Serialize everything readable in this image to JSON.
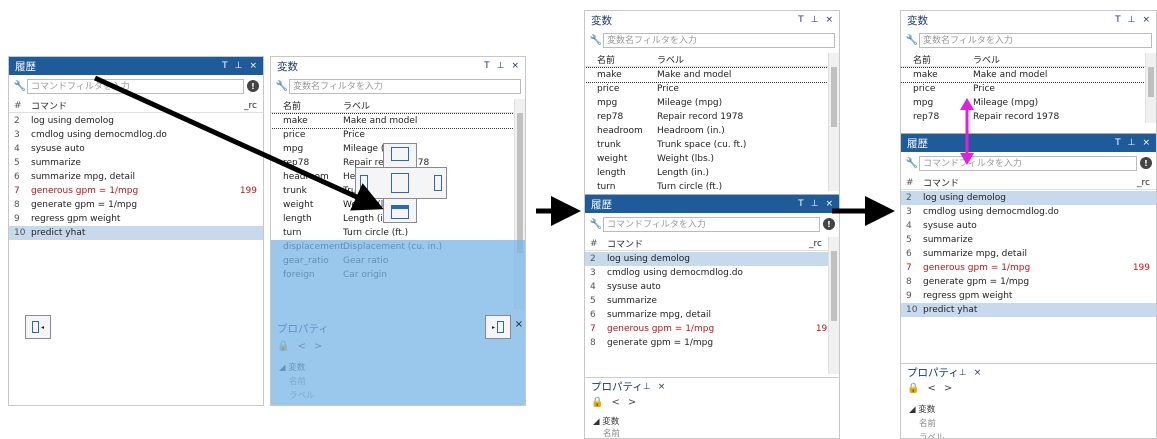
{
  "history": {
    "title": "履歴",
    "filter_placeholder": "コマンドフィルタを入力",
    "col_num": "#",
    "col_cmd": "コマンド",
    "col_rc": "_rc",
    "pin_t": "T",
    "pin_p": "⊥",
    "close": "×",
    "info": "!"
  },
  "history_rows_a": [
    {
      "n": "2",
      "c": "log using demolog",
      "rc": "",
      "err": false
    },
    {
      "n": "3",
      "c": "cmdlog using democmdlog.do",
      "rc": "",
      "err": false
    },
    {
      "n": "4",
      "c": "sysuse auto",
      "rc": "",
      "err": false
    },
    {
      "n": "5",
      "c": "summarize",
      "rc": "",
      "err": false
    },
    {
      "n": "6",
      "c": "summarize mpg, detail",
      "rc": "",
      "err": false
    },
    {
      "n": "7",
      "c": "generous gpm = 1/mpg",
      "rc": "199",
      "err": true
    },
    {
      "n": "8",
      "c": "generate gpm = 1/mpg",
      "rc": "",
      "err": false
    },
    {
      "n": "9",
      "c": "regress gpm weight",
      "rc": "",
      "err": false
    },
    {
      "n": "10",
      "c": "predict yhat",
      "rc": "",
      "err": false
    }
  ],
  "history_rows_b": [
    {
      "n": "2",
      "c": "log using demolog",
      "rc": "",
      "err": false
    },
    {
      "n": "3",
      "c": "cmdlog using democmdlog.do",
      "rc": "",
      "err": false
    },
    {
      "n": "4",
      "c": "sysuse auto",
      "rc": "",
      "err": false
    },
    {
      "n": "5",
      "c": "summarize",
      "rc": "",
      "err": false
    },
    {
      "n": "6",
      "c": "summarize mpg, detail",
      "rc": "",
      "err": false
    },
    {
      "n": "7",
      "c": "generous gpm = 1/mpg",
      "rc": "199",
      "err": true
    },
    {
      "n": "8",
      "c": "generate gpm = 1/mpg",
      "rc": "",
      "err": false
    }
  ],
  "history_rows_c": [
    {
      "n": "2",
      "c": "log using demolog",
      "rc": "",
      "err": false
    },
    {
      "n": "3",
      "c": "cmdlog using democmdlog.do",
      "rc": "",
      "err": false
    },
    {
      "n": "4",
      "c": "sysuse auto",
      "rc": "",
      "err": false
    },
    {
      "n": "5",
      "c": "summarize",
      "rc": "",
      "err": false
    },
    {
      "n": "6",
      "c": "summarize mpg, detail",
      "rc": "",
      "err": false
    },
    {
      "n": "7",
      "c": "generous gpm = 1/mpg",
      "rc": "199",
      "err": true
    },
    {
      "n": "8",
      "c": "generate gpm = 1/mpg",
      "rc": "",
      "err": false
    },
    {
      "n": "9",
      "c": "regress gpm weight",
      "rc": "",
      "err": false
    },
    {
      "n": "10",
      "c": "predict yhat",
      "rc": "",
      "err": false
    }
  ],
  "variables": {
    "title": "変数",
    "filter_placeholder": "変数名フィルタを入力",
    "col_name": "名前",
    "col_label": "ラベル"
  },
  "var_rows": [
    {
      "n": "make",
      "l": "Make and model"
    },
    {
      "n": "price",
      "l": "Price"
    },
    {
      "n": "mpg",
      "l": "Mileage (mpg)"
    },
    {
      "n": "rep78",
      "l": "Repair record 1978"
    },
    {
      "n": "headroom",
      "l": "Headroom (in.)"
    },
    {
      "n": "trunk",
      "l": "Trunk space (cu. ft.)"
    },
    {
      "n": "weight",
      "l": "Weight (lbs.)"
    },
    {
      "n": "length",
      "l": "Length (in.)"
    },
    {
      "n": "turn",
      "l": "Turn circle (ft.)"
    },
    {
      "n": "displacement",
      "l": "Displacement (cu. in.)"
    },
    {
      "n": "gear_ratio",
      "l": "Gear ratio"
    },
    {
      "n": "foreign",
      "l": "Car origin"
    }
  ],
  "properties": {
    "title": "プロパティ",
    "group": "◢ 変数",
    "name_label": "名前",
    "label_label": "ラベル",
    "lock": "🔒",
    "prev": "<",
    "next": ">",
    "pin_p": "⊥",
    "close": "×"
  },
  "colors": {
    "title_blue": "#1e5b9a",
    "selected": "#c7d9ed",
    "error": "#c0141a",
    "overlay": "#78b4e6",
    "resize_arrow": "#e020e0"
  }
}
